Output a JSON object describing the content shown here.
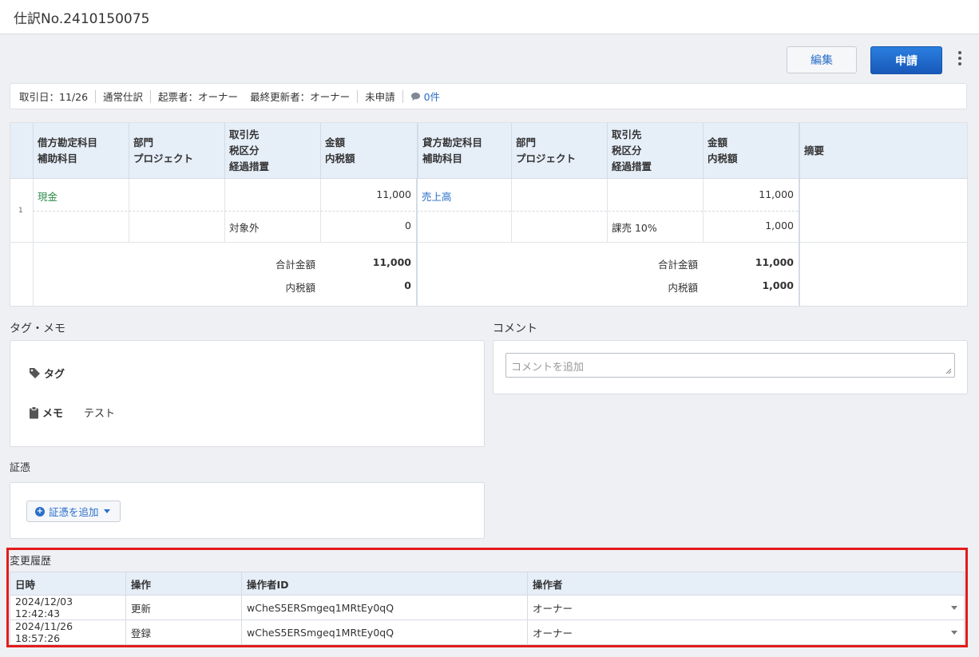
{
  "header": {
    "title": "仕訳No.2410150075"
  },
  "toolbar": {
    "edit_label": "編集",
    "apply_label": "申請",
    "more_icon": "vertical-ellipsis-icon"
  },
  "info": {
    "trade_date": "取引日：11/26",
    "type": "通常仕訳",
    "creator": "起票者：オーナー",
    "last_updater": "最終更新者：オーナー",
    "status": "未申請",
    "comment_count": "0件"
  },
  "journal": {
    "headers": {
      "debit_account": [
        "借方勘定科目",
        "補助科目"
      ],
      "debit_dept": [
        "部門",
        "プロジェクト"
      ],
      "debit_partner": [
        "取引先",
        "税区分",
        "経過措置"
      ],
      "debit_amount": [
        "金額",
        "内税額"
      ],
      "credit_account": [
        "貸方勘定科目",
        "補助科目"
      ],
      "credit_dept": [
        "部門",
        "プロジェクト"
      ],
      "credit_partner": [
        "取引先",
        "税区分",
        "経過措置"
      ],
      "credit_amount": [
        "金額",
        "内税額"
      ],
      "memo": "摘要"
    },
    "row": {
      "index": "1",
      "debit_account": "現金",
      "debit_amount": "11,000",
      "debit_tax_class": "対象外",
      "debit_tax_amount": "0",
      "credit_account": "売上高",
      "credit_amount": "11,000",
      "credit_tax_class": "課売 10%",
      "credit_tax_amount": "1,000"
    },
    "totals": {
      "total_label": "合計金額",
      "tax_label": "内税額",
      "debit_total": "11,000",
      "debit_tax": "0",
      "credit_total": "11,000",
      "credit_tax": "1,000"
    }
  },
  "tag_memo": {
    "section_title": "タグ・メモ",
    "tag_label": "タグ",
    "memo_label": "メモ",
    "memo_value": "テスト"
  },
  "comment": {
    "section_title": "コメント",
    "placeholder": "コメントを追加"
  },
  "evidence": {
    "section_title": "証憑",
    "add_label": "証憑を追加"
  },
  "history": {
    "title": "変更履歴",
    "columns": [
      "日時",
      "操作",
      "操作者ID",
      "操作者"
    ],
    "rows": [
      {
        "datetime": "2024/12/03 12:42:43",
        "action": "更新",
        "operator_id": "wCheS5ERSmgeq1MRtEy0qQ",
        "operator": "オーナー"
      },
      {
        "datetime": "2024/11/26 18:57:26",
        "action": "登録",
        "operator_id": "wCheS5ERSmgeq1MRtEy0qQ",
        "operator": "オーナー"
      }
    ]
  },
  "colors": {
    "accent": "#2a6fc9",
    "primary_button": "#1f6dd3",
    "highlight_frame": "#e31b1b",
    "header_bg": "#e6eef8"
  }
}
